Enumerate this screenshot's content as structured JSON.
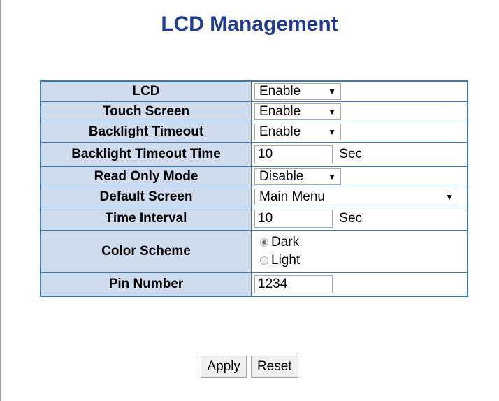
{
  "title": "LCD Management",
  "rows": {
    "lcd": {
      "label": "LCD",
      "value": "Enable"
    },
    "touch": {
      "label": "Touch Screen",
      "value": "Enable"
    },
    "backlight": {
      "label": "Backlight Timeout",
      "value": "Enable"
    },
    "backlight_time": {
      "label": "Backlight Timeout Time",
      "value": "10",
      "unit": "Sec"
    },
    "readonly": {
      "label": "Read Only Mode",
      "value": "Disable"
    },
    "default_screen": {
      "label": "Default Screen",
      "value": "Main Menu"
    },
    "interval": {
      "label": "Time Interval",
      "value": "10",
      "unit": "Sec"
    },
    "color": {
      "label": "Color Scheme",
      "options": [
        "Dark",
        "Light"
      ],
      "selected": "Dark"
    },
    "pin": {
      "label": "Pin Number",
      "value": "1234"
    }
  },
  "buttons": {
    "apply": "Apply",
    "reset": "Reset"
  },
  "icons": {
    "dropdown": "dropdown-arrow-icon"
  }
}
